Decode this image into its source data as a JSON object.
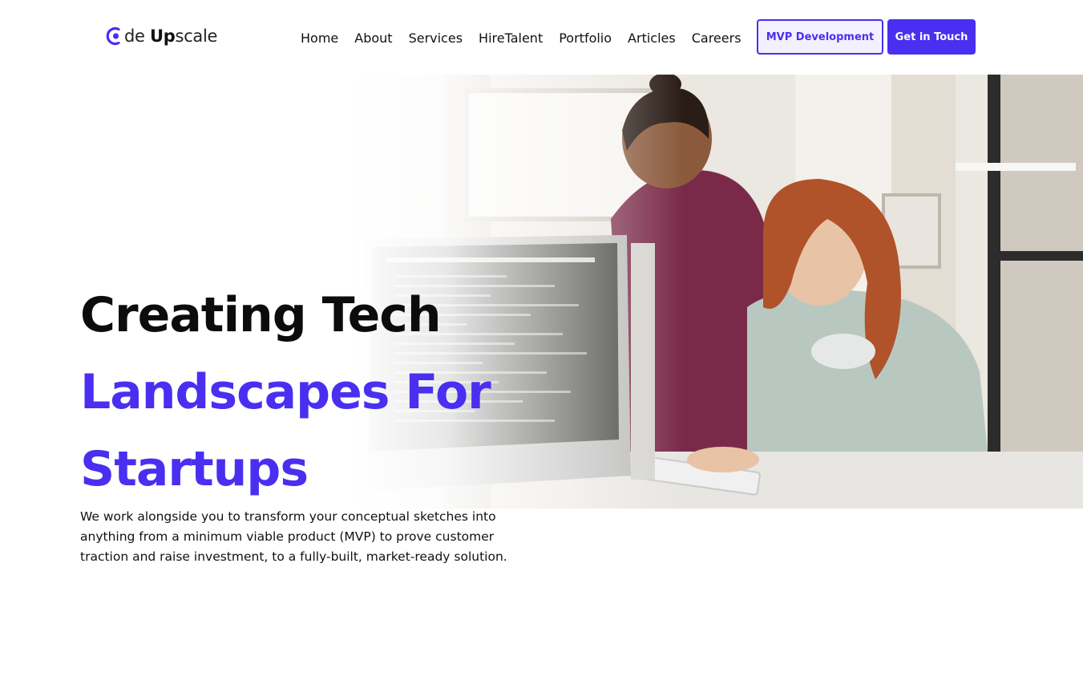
{
  "brand": {
    "logo_prefix": "de",
    "logo_bold": "Up",
    "logo_suffix": "scale",
    "accent_color": "#4a2ff0"
  },
  "nav": {
    "items": [
      {
        "label": "Home"
      },
      {
        "label": "About"
      },
      {
        "label": "Services"
      },
      {
        "label": "HireTalent"
      },
      {
        "label": "Portfolio"
      },
      {
        "label": "Articles"
      },
      {
        "label": "Careers"
      }
    ],
    "mvp_button": "MVP Development",
    "contact_button": "Get in Touch"
  },
  "hero": {
    "headline_line1": "Creating Tech",
    "headline_line2": "Landscapes For",
    "headline_line3": "Startups",
    "description": "We work alongside you to transform your conceptual sketches into anything from a minimum viable product (MVP) to prove customer traction and raise investment, to a fully-built, market-ready solution.",
    "image_icon": "team-at-computer-photo"
  }
}
